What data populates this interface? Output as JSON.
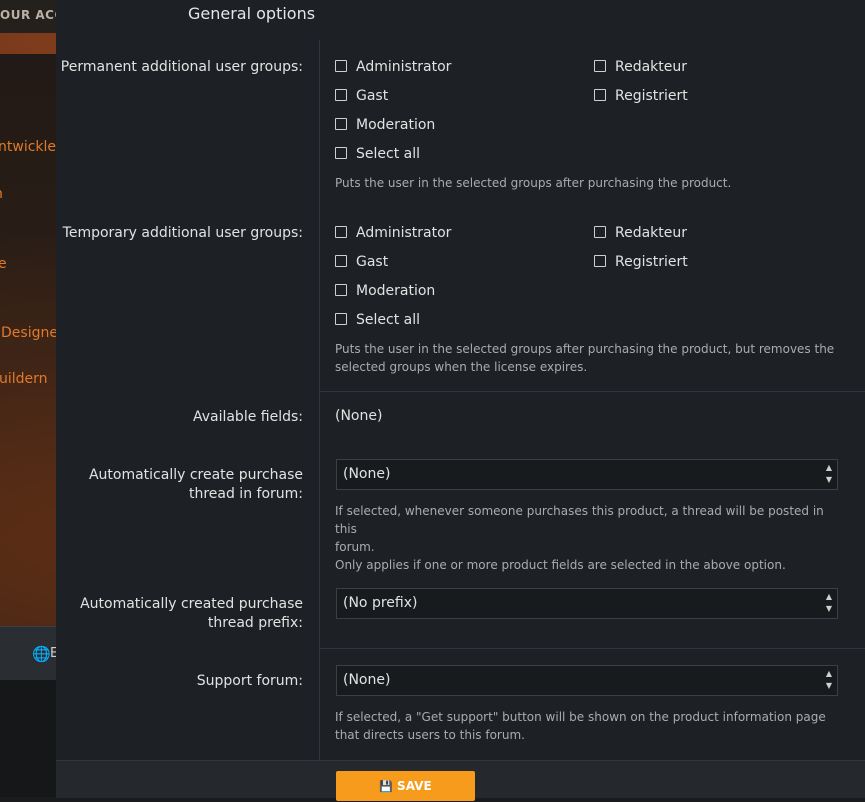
{
  "background": {
    "topbar_text": "OUR ACC",
    "menu_links": [
      "ntwickler",
      "n",
      "e",
      "Designer",
      "uildern"
    ],
    "navbar_left_text": "E",
    "navbar_right_text": "EL"
  },
  "modal": {
    "title": "General options",
    "permanent_groups": {
      "label": "Permanent additional user groups:",
      "options": [
        "Administrator",
        "Redakteur",
        "Gast",
        "Registriert",
        "Moderation",
        "Select all"
      ],
      "description": "Puts the user in the selected groups after purchasing the product."
    },
    "temporary_groups": {
      "label": "Temporary additional user groups:",
      "options": [
        "Administrator",
        "Redakteur",
        "Gast",
        "Registriert",
        "Moderation",
        "Select all"
      ],
      "description_line1": "Puts the user in the selected groups after purchasing the product, but removes the",
      "description_line2": "selected groups when the license expires."
    },
    "available_fields": {
      "label": "Available fields:",
      "value": "(None)"
    },
    "purchase_thread_forum": {
      "label_line1": "Automatically create purchase",
      "label_line2": "thread in forum:",
      "selected": "(None)",
      "description_line1": "If selected, whenever someone purchases this product, a thread will be posted in this",
      "description_line2": "forum.",
      "description_line3": "Only applies if one or more product fields are selected in the above option."
    },
    "purchase_thread_prefix": {
      "label_line1": "Automatically created purchase",
      "label_line2": "thread prefix:",
      "selected": "(No prefix)"
    },
    "support_forum": {
      "label": "Support forum:",
      "selected": "(None)",
      "description_line1": "If selected, a \"Get support\" button will be shown on the product information page",
      "description_line2": "that directs users to this forum."
    },
    "save_label": "SAVE"
  },
  "colors": {
    "accent": "#f79b1c",
    "modal_bg": "#1d2125",
    "link": "#e07a2a"
  }
}
